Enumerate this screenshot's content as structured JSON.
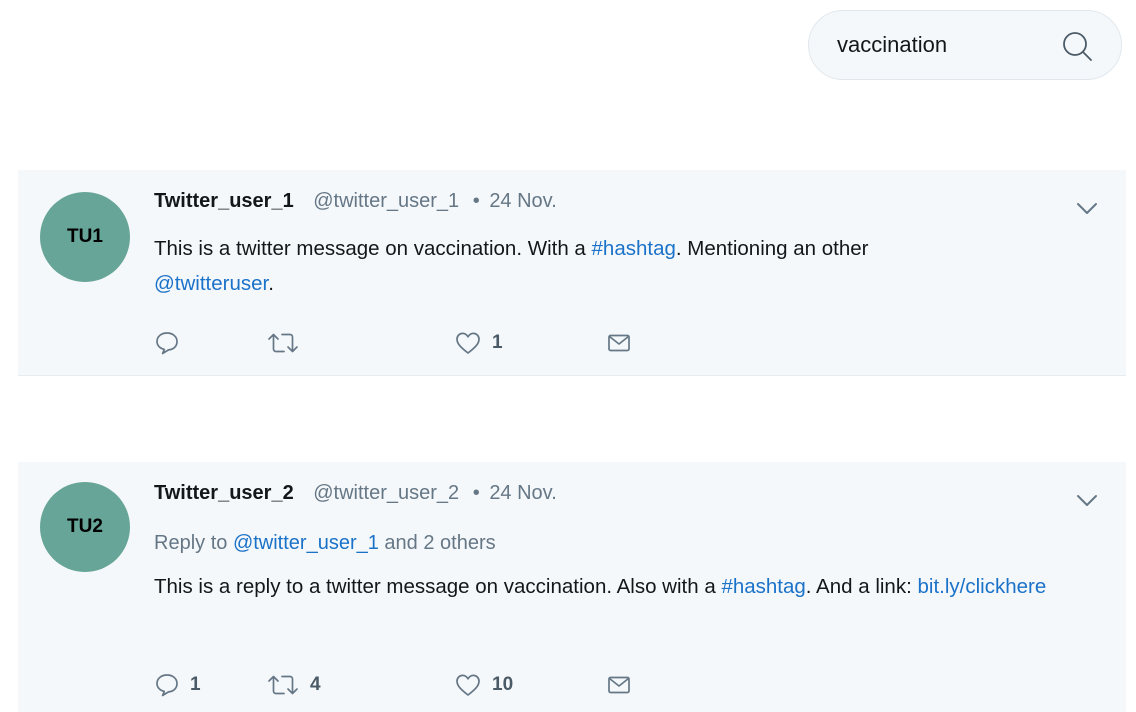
{
  "search": {
    "value": "vaccination",
    "icon": "search-icon"
  },
  "colors": {
    "avatar_bg": "#66a597",
    "link": "#1b72c9",
    "tweet_bg": "#f5f8fa",
    "muted": "#657786"
  },
  "tweets": [
    {
      "avatar_initials": "TU1",
      "display_name": "Twitter_user_1",
      "handle": "@twitter_user_1",
      "separator": "•",
      "date": "24 Nov.",
      "text": {
        "part1": "This is a twitter message on vaccination. With a ",
        "hashtag": "#hashtag",
        "part2": ". Mentioning an other ",
        "mention": "@twitteruser",
        "part3": "."
      },
      "actions": {
        "replies": "",
        "retweets": "",
        "likes": "1"
      }
    },
    {
      "avatar_initials": "TU2",
      "display_name": "Twitter_user_2",
      "handle": "@twitter_user_2",
      "separator": "•",
      "date": "24 Nov.",
      "reply_to": {
        "prefix": "Reply to ",
        "mention": "@twitter_user_1",
        "suffix": " and 2 others"
      },
      "text": {
        "part1": "This is a reply to a twitter message on vaccination. Also with a ",
        "hashtag": "#hashtag",
        "part2": ". And a link: ",
        "link": "bit.ly/clickhere"
      },
      "actions": {
        "replies": "1",
        "retweets": "4",
        "likes": "10"
      }
    }
  ]
}
